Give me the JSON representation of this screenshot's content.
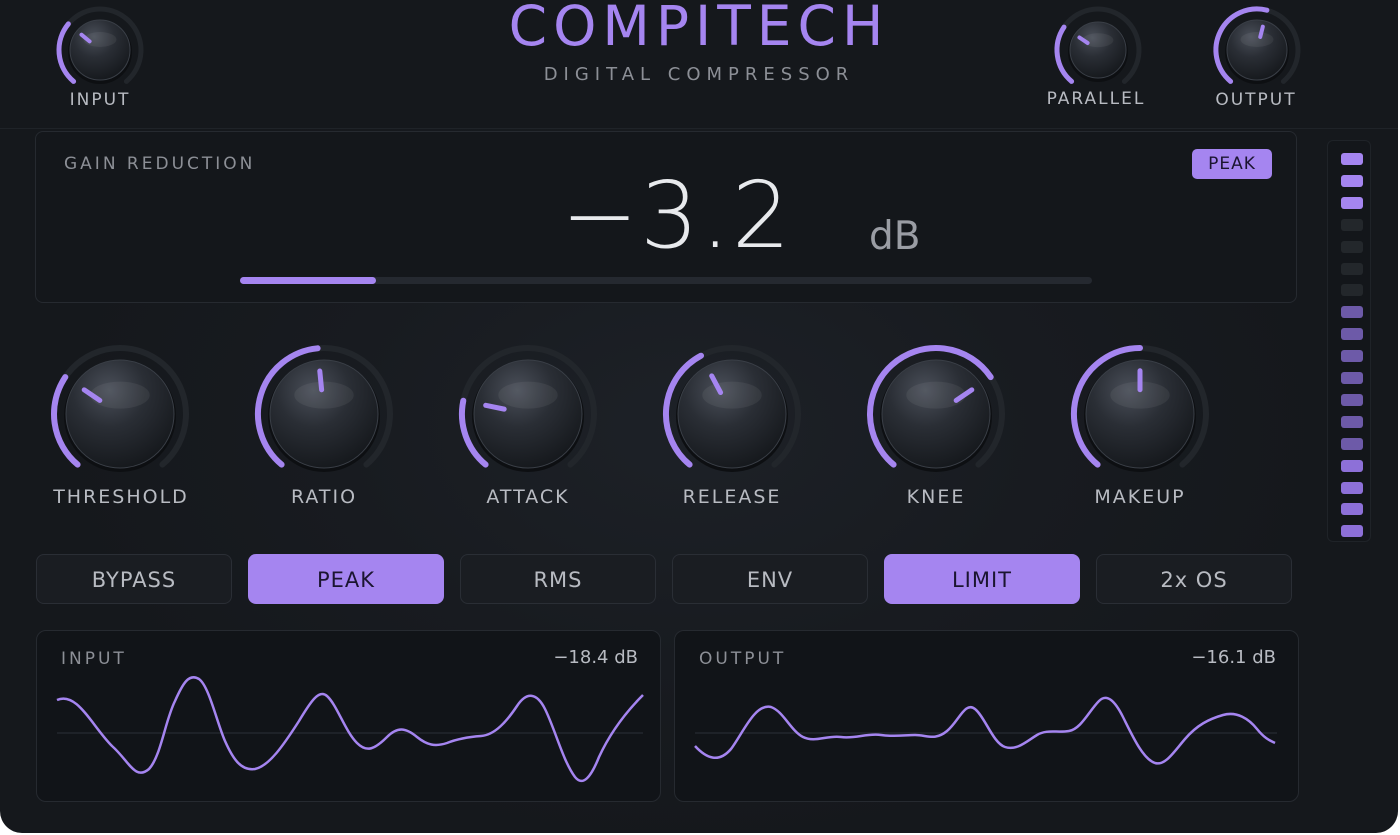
{
  "header": {
    "title": "COMPITECH",
    "subtitle": "DIGITAL COMPRESSOR"
  },
  "top_knobs": {
    "input": {
      "label": "INPUT",
      "level": 0.32
    },
    "parallel": {
      "label": "PARALLEL",
      "level": 0.3
    },
    "output": {
      "label": "OUTPUT",
      "level": 0.55
    }
  },
  "gain_reduction": {
    "title": "GAIN REDUCTION",
    "value": "−3.2",
    "unit": "dB",
    "badge": "PEAK",
    "bar_level": 0.16
  },
  "main_knobs": [
    {
      "label": "THRESHOLD",
      "level": 0.3
    },
    {
      "label": "RATIO",
      "level": 0.48
    },
    {
      "label": "ATTACK",
      "level": 0.22
    },
    {
      "label": "RELEASE",
      "level": 0.4
    },
    {
      "label": "KNEE",
      "level": 0.7
    },
    {
      "label": "MAKEUP",
      "level": 0.5
    }
  ],
  "modes": [
    {
      "label": "BYPASS",
      "active": false
    },
    {
      "label": "PEAK",
      "active": true
    },
    {
      "label": "RMS",
      "active": false
    },
    {
      "label": "ENV",
      "active": false
    },
    {
      "label": "LIMIT",
      "active": true
    },
    {
      "label": "2x OS",
      "active": false
    }
  ],
  "meter": {
    "segments": 18,
    "top_lit": 3,
    "bottom_lit": 11
  },
  "scopes": {
    "input": {
      "title": "INPUT",
      "level": "−18.4 dB"
    },
    "output": {
      "title": "OUTPUT",
      "level": "−16.1 dB"
    }
  },
  "colors": {
    "accent": "#a585f0",
    "accent_dim": "#6d5aa8",
    "meter_off": "#23272b",
    "background": "#181b20",
    "text": "#b8bbc2"
  }
}
